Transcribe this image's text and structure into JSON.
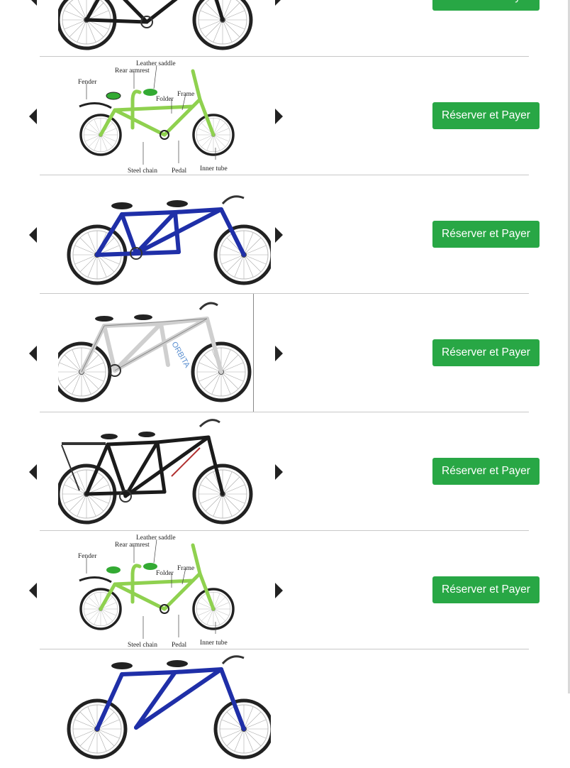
{
  "reserve_label": "Réserver et Payer",
  "accent_color": "#28a745",
  "folding_labels": {
    "leather_saddle": "Leather saddle",
    "rear_armrest": "Rear armrest",
    "fender": "Fender",
    "folder": "Folder",
    "frame": "Frame",
    "steel_chain": "Steel chain",
    "pedal": "Pedal",
    "inner_tube": "Inner tube"
  },
  "white_bike_brand": "ORBITA",
  "bikes": [
    {
      "variant": "black-tandem"
    },
    {
      "variant": "green-folding-diagram"
    },
    {
      "variant": "blue-tandem"
    },
    {
      "variant": "white-tandem"
    },
    {
      "variant": "black-tandem"
    },
    {
      "variant": "green-folding-diagram"
    },
    {
      "variant": "blue-tandem"
    }
  ],
  "icons": {
    "prev": "caret-left-icon",
    "next": "caret-right-icon"
  }
}
